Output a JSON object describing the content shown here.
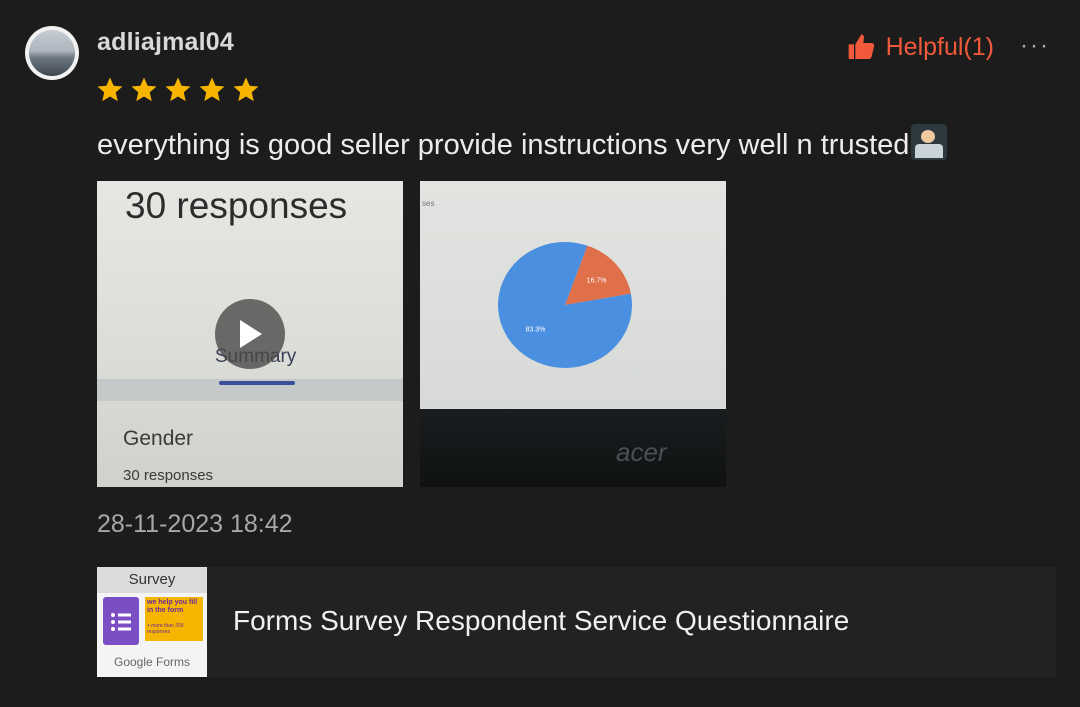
{
  "review": {
    "username": "adliajmal04",
    "rating": 5,
    "rating_max": 5,
    "helpful_label": "Helpful(1)",
    "more_label": "···",
    "text": "everything is good seller provide instructions very well n trusted",
    "date": "28-11-2023 18:42"
  },
  "photos": [
    {
      "type": "video",
      "title": "30 responses",
      "tab": "Summary",
      "section": "Gender",
      "sub": "30 responses"
    },
    {
      "type": "image",
      "tag": "ses",
      "brand": "acer",
      "pie_chart": {
        "slices": [
          {
            "label": "83.3%",
            "value": 83.3,
            "color": "#4a8fe0"
          },
          {
            "label": "16.7%",
            "value": 16.7,
            "color": "#e0704a"
          }
        ]
      }
    }
  ],
  "product": {
    "title": "Forms Survey Respondent Service Questionnaire",
    "thumb_header": "Survey",
    "thumb_line1": "we help you fill in the form",
    "thumb_line2": "+ more than 200 responses",
    "thumb_brand": "Google Forms"
  },
  "colors": {
    "background": "#1c1c1c",
    "accent": "#f05a3a",
    "star": "#f7b500"
  }
}
